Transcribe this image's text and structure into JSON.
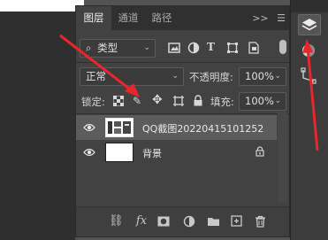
{
  "tabs": [
    {
      "label": "图层",
      "active": true
    },
    {
      "label": "通道",
      "active": false
    },
    {
      "label": "路径",
      "active": false
    }
  ],
  "tab_overflow": ">>",
  "filter": {
    "label": "类型",
    "icon": "search-icon"
  },
  "blend_mode": "正常",
  "opacity": {
    "label": "不透明度:",
    "value": "100%"
  },
  "lock": {
    "label": "锁定:"
  },
  "fill": {
    "label": "填充:",
    "value": "100%"
  },
  "layers": [
    {
      "name": "QQ截图20220415101252",
      "selected": true,
      "locked": false
    },
    {
      "name": "背景",
      "selected": false,
      "locked": true
    }
  ],
  "bottom_icons": [
    "link-icon",
    "fx-icon",
    "mask-icon",
    "adjustment-icon",
    "folder-icon",
    "new-layer-icon",
    "trash-icon"
  ],
  "bottom_labels": {
    "fx": "fx"
  },
  "accent_red": "#e8262b"
}
